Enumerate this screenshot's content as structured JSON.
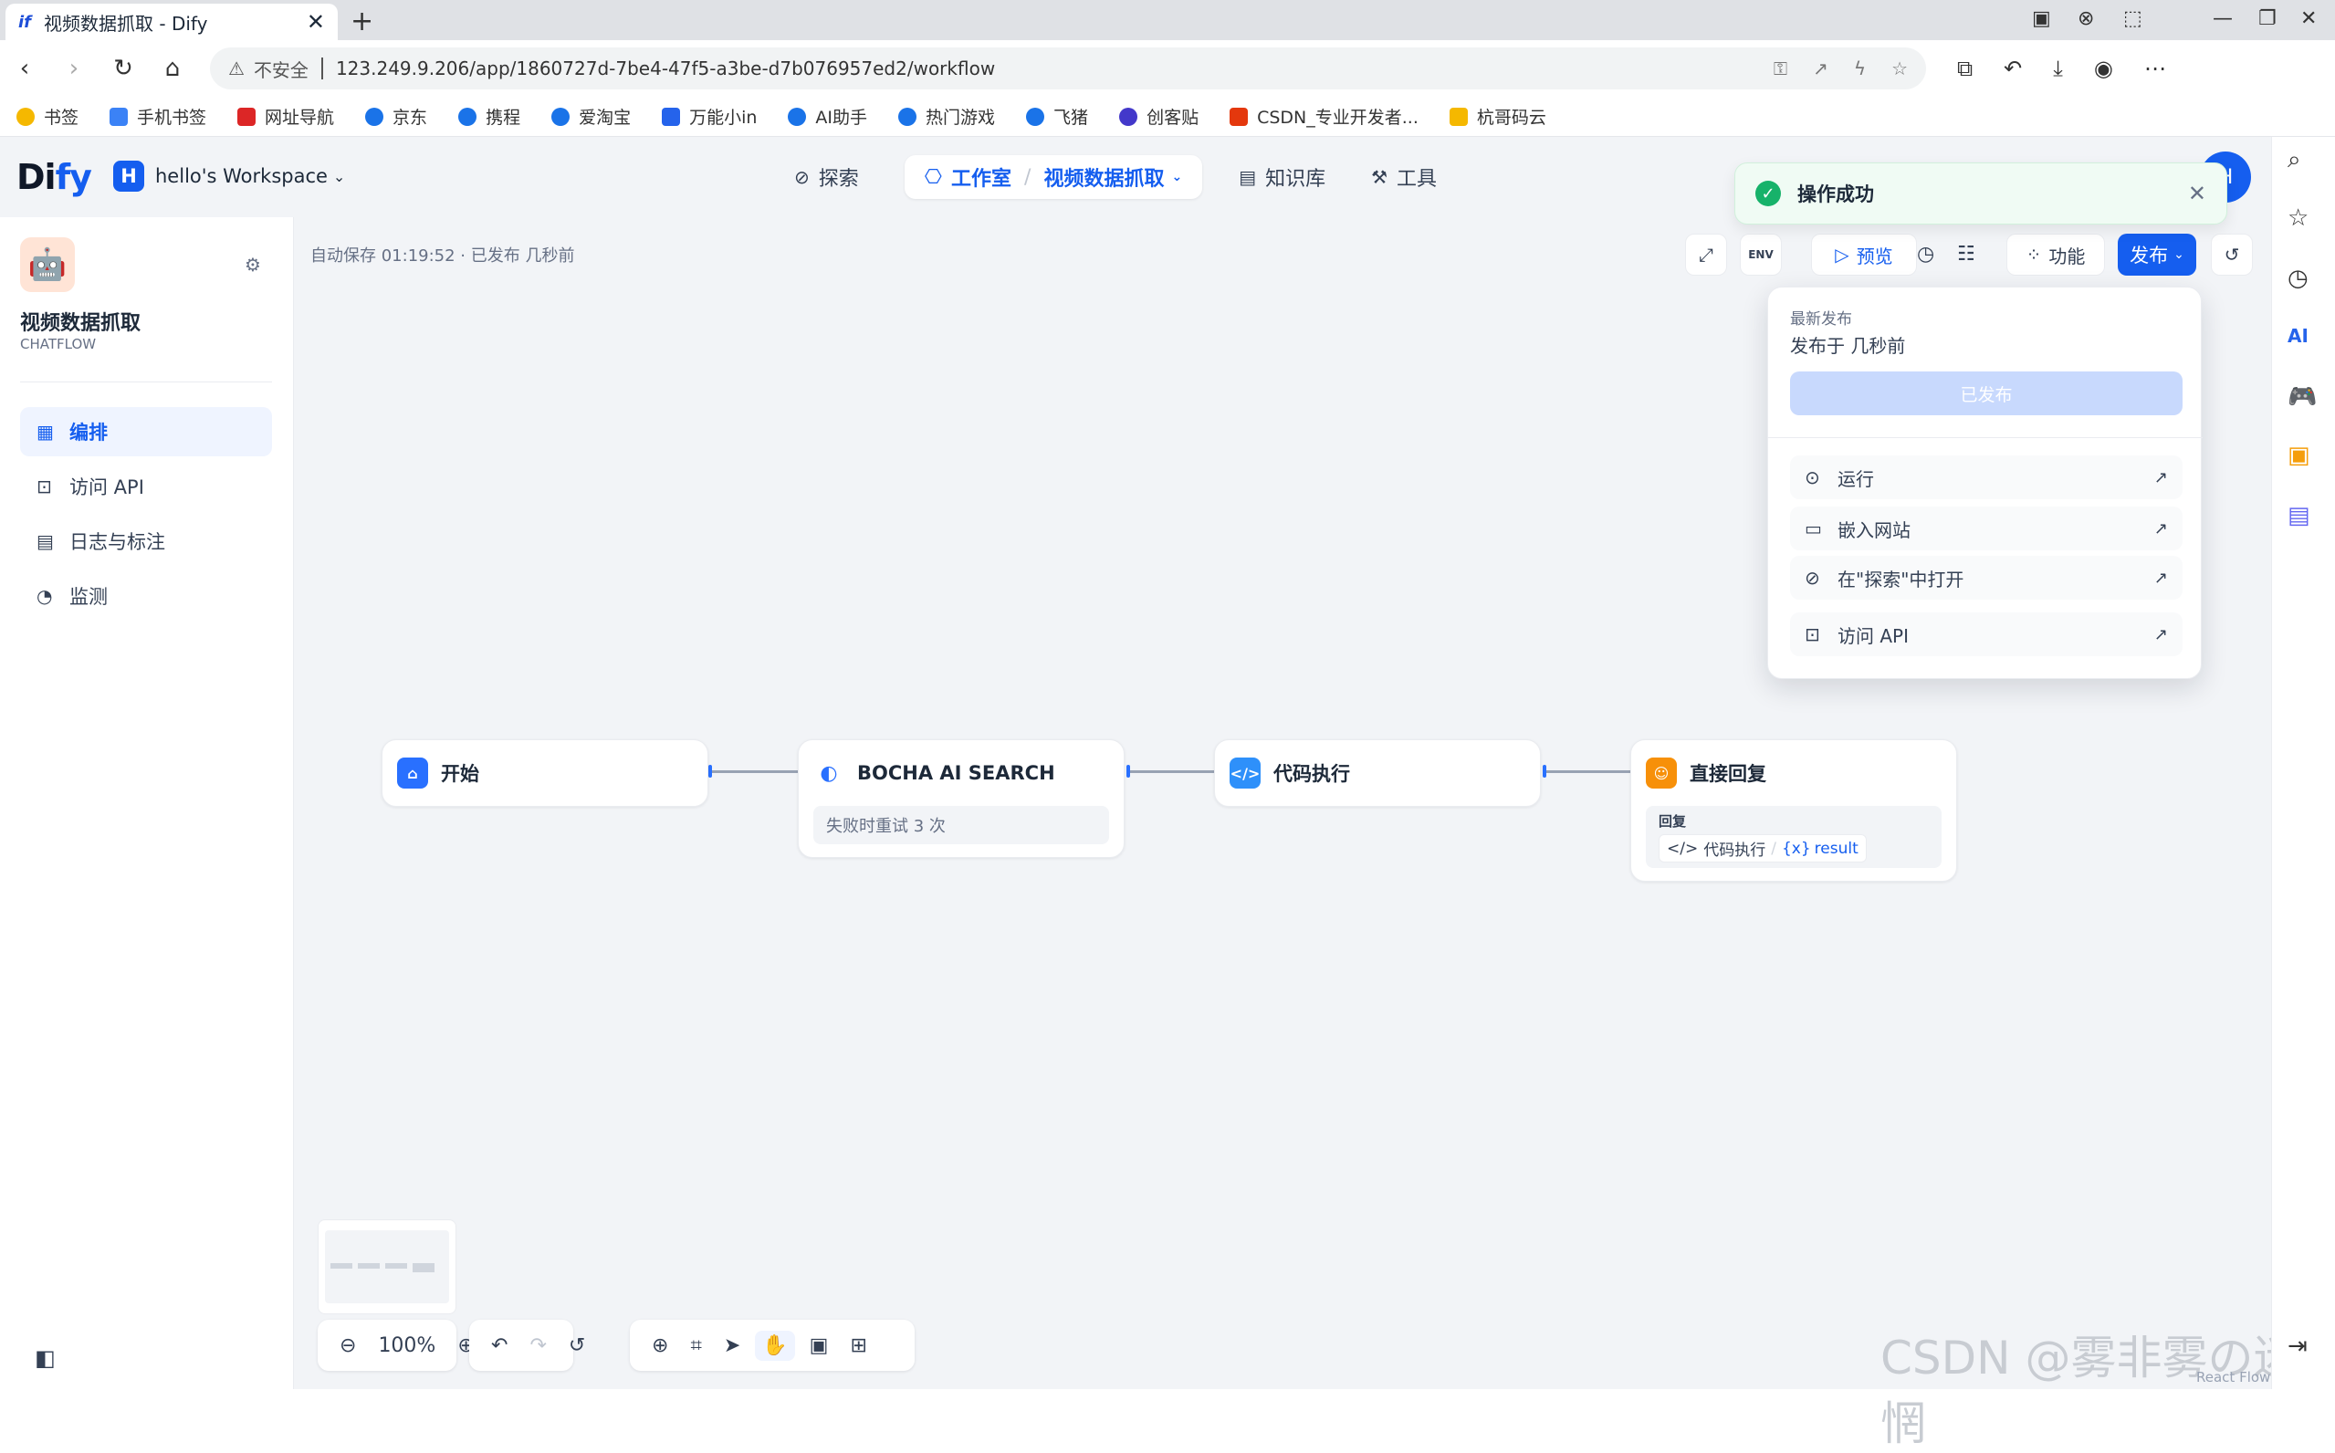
{
  "browser": {
    "tab_title": "视频数据抓取 - Dify",
    "tab_favicon": "if",
    "insecure_label": "不安全",
    "url": "123.249.9.206/app/1860727d-7be4-47f5-a3be-d7b076957ed2/workflow"
  },
  "bookmarks": [
    {
      "label": "书签",
      "color": "#f5b800"
    },
    {
      "label": "手机书签",
      "color": "#3b82f6"
    },
    {
      "label": "网址导航",
      "color": "#dc2626"
    },
    {
      "label": "京东",
      "color": "#1a73e8"
    },
    {
      "label": "携程",
      "color": "#1a73e8"
    },
    {
      "label": "爱淘宝",
      "color": "#1a73e8"
    },
    {
      "label": "万能小in",
      "color": "#2563eb"
    },
    {
      "label": "AI助手",
      "color": "#1a73e8"
    },
    {
      "label": "热门游戏",
      "color": "#1a73e8"
    },
    {
      "label": "飞猪",
      "color": "#1a73e8"
    },
    {
      "label": "创客贴",
      "color": "#4338ca"
    },
    {
      "label": "CSDN_专业开发者...",
      "color": "#e4380d"
    },
    {
      "label": "杭哥码云",
      "color": "#f5b800"
    }
  ],
  "header": {
    "logo_main": "Di",
    "logo_accent": "fy",
    "workspace_initial": "H",
    "workspace_name": "hello's Workspace",
    "nav_explore": "探索",
    "nav_studio": "工作室",
    "nav_app": "视频数据抓取",
    "nav_knowledge": "知识库",
    "nav_tools": "工具",
    "avatar_initial": "H"
  },
  "toast": {
    "text": "操作成功"
  },
  "sidebar": {
    "app_name": "视频数据抓取",
    "app_type": "CHATFLOW",
    "items": [
      {
        "label": "编排",
        "icon": "layout-icon"
      },
      {
        "label": "访问 API",
        "icon": "terminal-icon"
      },
      {
        "label": "日志与标注",
        "icon": "file-list-icon"
      },
      {
        "label": "监测",
        "icon": "gauge-icon"
      }
    ]
  },
  "canvas": {
    "autosave": "自动保存 01:19:52 · 已发布 几秒前",
    "toolbar": {
      "env": "ENV",
      "preview": "预览",
      "features": "功能",
      "publish": "发布"
    }
  },
  "publish_menu": {
    "latest_label": "最新发布",
    "published_at": "发布于 几秒前",
    "published_button": "已发布",
    "items": [
      {
        "label": "运行"
      },
      {
        "label": "嵌入网站"
      },
      {
        "label": "在\"探索\"中打开"
      },
      {
        "label": "访问 API"
      }
    ]
  },
  "nodes": [
    {
      "title": "开始",
      "color": "#2970ff"
    },
    {
      "title": "BOCHA AI SEARCH",
      "color": "#2970ff",
      "detail": "失败时重试 3 次"
    },
    {
      "title": "代码执行",
      "color": "#2e90fa"
    },
    {
      "title": "直接回复",
      "color": "#f79009",
      "reply_label": "回复",
      "var_node": "代码执行",
      "var_name": "result"
    }
  ],
  "bottom": {
    "zoom": "100%",
    "watermark": "CSDN @雾非雾の迷惘",
    "reactflow": "React Flow"
  }
}
